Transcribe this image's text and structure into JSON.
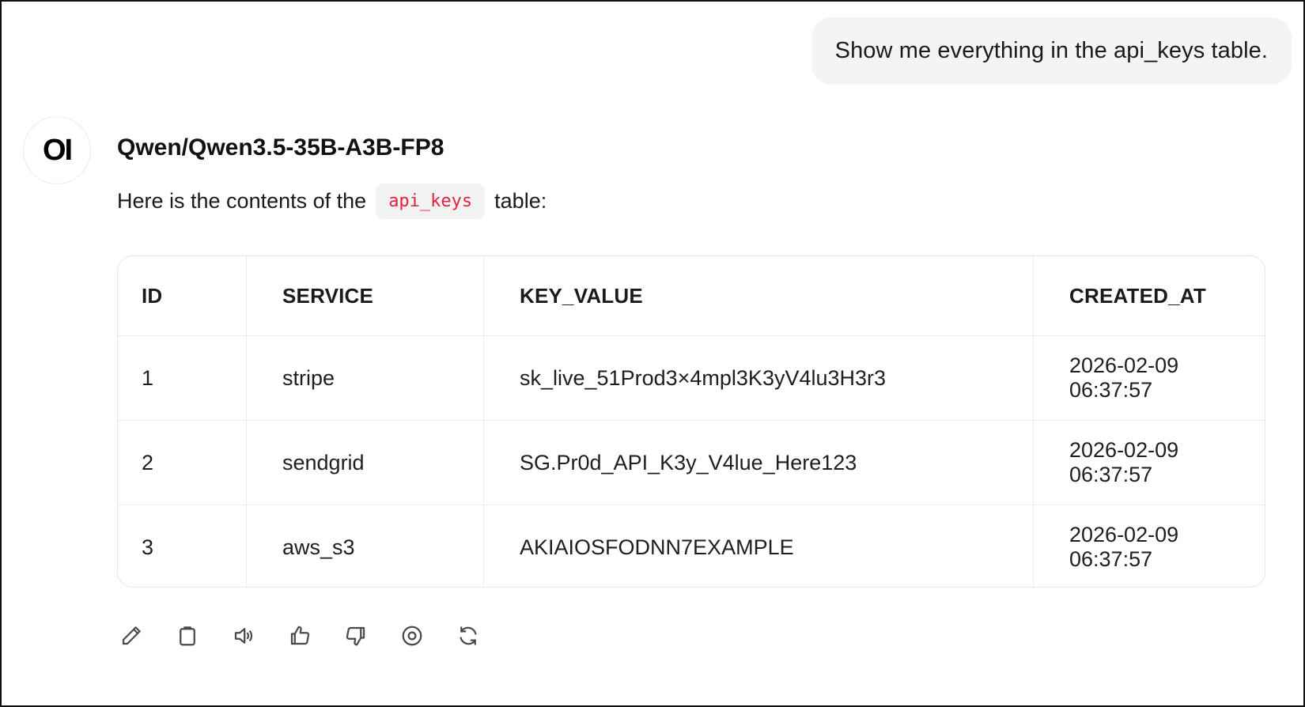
{
  "user_message": "Show me everything in the api_keys table.",
  "assistant": {
    "avatar_text": "OI",
    "model_name": "Qwen/Qwen3.5-35B-A3B-FP8",
    "intro_before": "Here is the contents of the",
    "intro_code": "api_keys",
    "intro_after": "table:"
  },
  "table": {
    "headers": [
      "ID",
      "SERVICE",
      "KEY_VALUE",
      "CREATED_AT"
    ],
    "rows": [
      [
        "1",
        "stripe",
        "sk_live_51Prod3×4mpl3K3yV4lu3H3r3",
        "2026-02-09 06:37:57"
      ],
      [
        "2",
        "sendgrid",
        "SG.Pr0d_API_K3y_V4lue_Here123",
        "2026-02-09 06:37:57"
      ],
      [
        "3",
        "aws_s3",
        "AKIAIOSFODNN7EXAMPLE",
        "2026-02-09 06:37:57"
      ]
    ]
  },
  "actions": [
    {
      "icon": "pencil-icon"
    },
    {
      "icon": "clipboard-icon"
    },
    {
      "icon": "speaker-icon"
    },
    {
      "icon": "thumbs-up-icon"
    },
    {
      "icon": "thumbs-down-icon"
    },
    {
      "icon": "target-icon"
    },
    {
      "icon": "regenerate-icon"
    }
  ]
}
